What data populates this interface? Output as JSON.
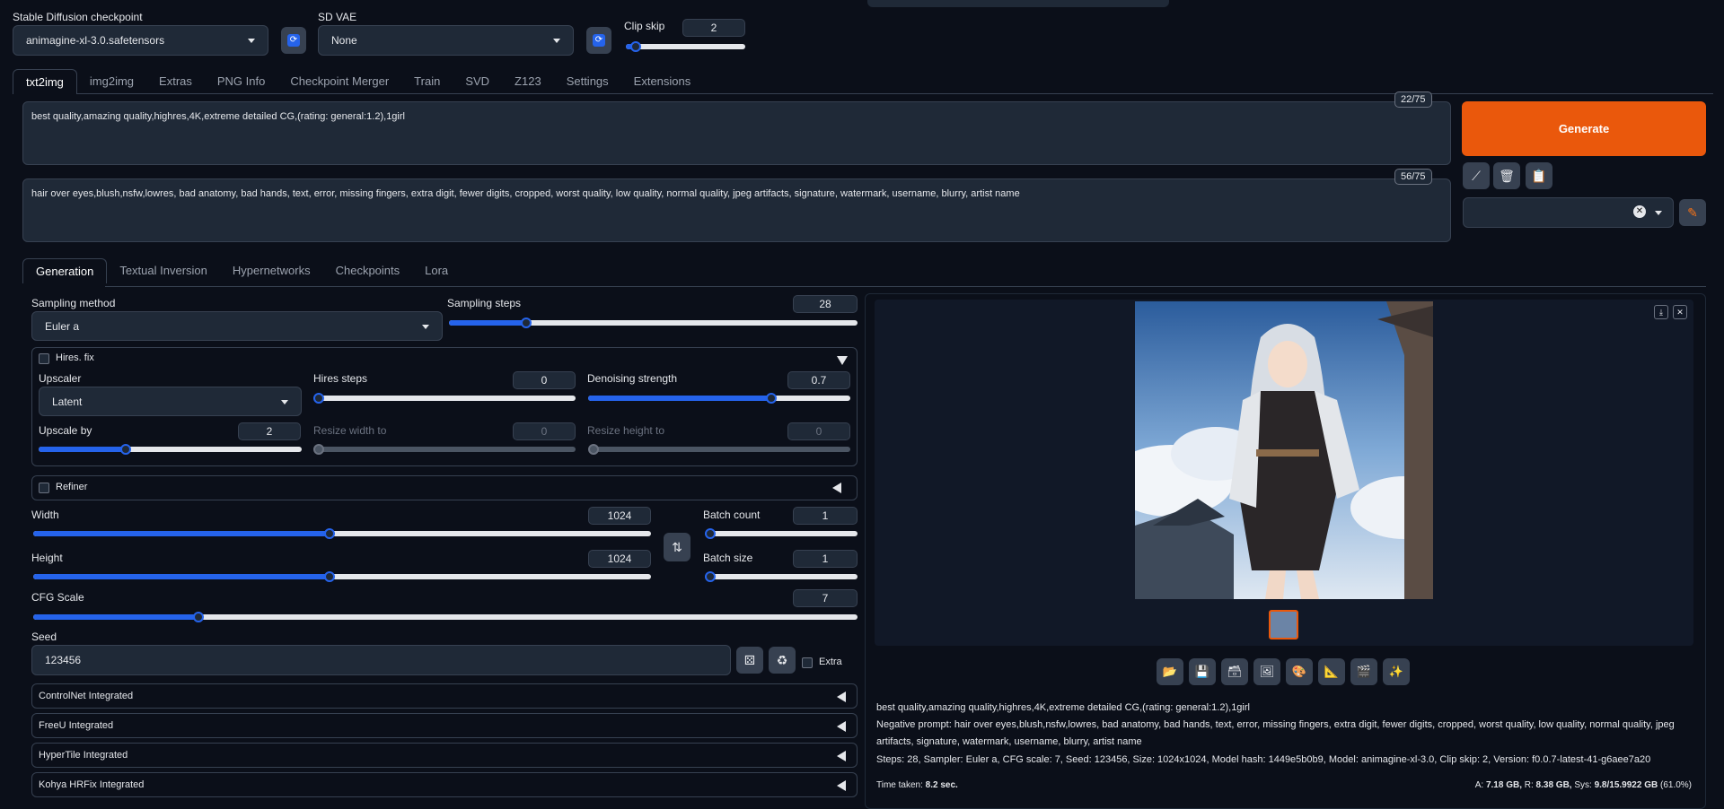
{
  "header": {
    "checkpoint_label": "Stable Diffusion checkpoint",
    "checkpoint_value": "animagine-xl-3.0.safetensors",
    "vae_label": "SD VAE",
    "vae_value": "None",
    "clip_skip_label": "Clip skip",
    "clip_skip_value": "2"
  },
  "main_tabs": [
    "txt2img",
    "img2img",
    "Extras",
    "PNG Info",
    "Checkpoint Merger",
    "Train",
    "SVD",
    "Z123",
    "Settings",
    "Extensions"
  ],
  "prompt": {
    "positive": "best quality,amazing quality,highres,4K,extreme detailed CG,(rating: general:1.2),1girl",
    "positive_counter": "22/75",
    "negative": "hair over eyes,blush,nsfw,lowres, bad anatomy, bad hands, text, error, missing fingers, extra digit, fewer digits, cropped, worst quality, low quality, normal quality, jpeg artifacts, signature, watermark, username, blurry, artist name",
    "negative_counter": "56/75"
  },
  "generate_label": "Generate",
  "sub_tabs": [
    "Generation",
    "Textual Inversion",
    "Hypernetworks",
    "Checkpoints",
    "Lora"
  ],
  "generation": {
    "sampling_method_label": "Sampling method",
    "sampling_method_value": "Euler a",
    "sampling_steps_label": "Sampling steps",
    "sampling_steps_value": "28",
    "hires_fix_label": "Hires. fix",
    "upscaler_label": "Upscaler",
    "upscaler_value": "Latent",
    "hires_steps_label": "Hires steps",
    "hires_steps_value": "0",
    "denoising_label": "Denoising strength",
    "denoising_value": "0.7",
    "upscale_by_label": "Upscale by",
    "upscale_by_value": "2",
    "resize_width_label": "Resize width to",
    "resize_width_value": "0",
    "resize_height_label": "Resize height to",
    "resize_height_value": "0",
    "refiner_label": "Refiner",
    "width_label": "Width",
    "width_value": "1024",
    "height_label": "Height",
    "height_value": "1024",
    "batch_count_label": "Batch count",
    "batch_count_value": "1",
    "batch_size_label": "Batch size",
    "batch_size_value": "1",
    "cfg_label": "CFG Scale",
    "cfg_value": "7",
    "seed_label": "Seed",
    "seed_value": "123456",
    "extra_label": "Extra"
  },
  "accordions": [
    "ControlNet Integrated",
    "FreeU Integrated",
    "HyperTile Integrated",
    "Kohya HRFix Integrated"
  ],
  "output": {
    "info_prompt": "best quality,amazing quality,highres,4K,extreme detailed CG,(rating: general:1.2),1girl",
    "info_negative": "Negative prompt: hair over eyes,blush,nsfw,lowres, bad anatomy, bad hands, text, error, missing fingers, extra digit, fewer digits, cropped, worst quality, low quality, normal quality, jpeg artifacts, signature, watermark, username, blurry, artist name",
    "info_params": "Steps: 28, Sampler: Euler a, CFG scale: 7, Seed: 123456, Size: 1024x1024, Model hash: 1449e5b0b9, Model: animagine-xl-3.0, Clip skip: 2, Version: f0.0.7-latest-41-g6aee7a20",
    "time_label": "Time taken:",
    "time_value": "8.2 sec.",
    "mem_a_label": "A:",
    "mem_a_value": "7.18 GB,",
    "mem_r_label": "R:",
    "mem_r_value": "8.38 GB,",
    "mem_sys_label": "Sys:",
    "mem_sys_value": "9.8/15.9922 GB",
    "mem_pct": "(61.0%)"
  },
  "colors": {
    "accent": "#2563eb",
    "generate": "#ea580c",
    "background": "#0b0f19"
  },
  "slider_levels": {
    "clip_skip": 0.08,
    "sampling_steps": 0.19,
    "hires_steps": 0.0,
    "denoising": 0.7,
    "upscale_by": 0.33,
    "width": 0.48,
    "height": 0.48,
    "batch_count": 0.0,
    "batch_size": 0.0,
    "cfg": 0.2
  }
}
